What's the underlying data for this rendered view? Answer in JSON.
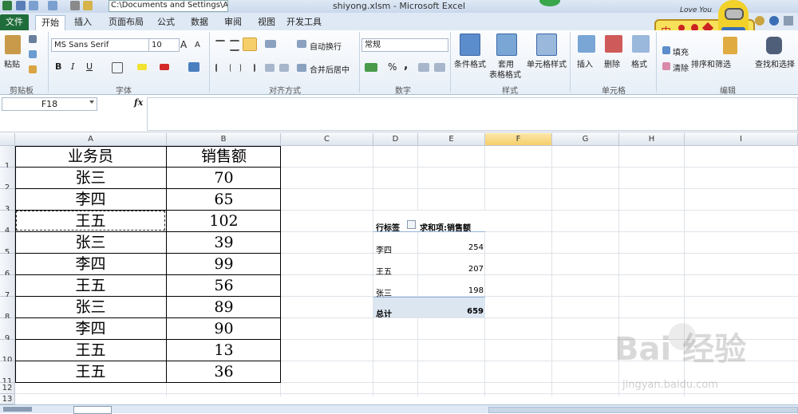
{
  "window": {
    "title": "shiyong.xlsm - Microsoft Excel",
    "path_field": "C:\\Documents and Settings\\Adr"
  },
  "tabs": [
    {
      "label": "文件"
    },
    {
      "label": "开始"
    },
    {
      "label": "插入"
    },
    {
      "label": "页面布局"
    },
    {
      "label": "公式"
    },
    {
      "label": "数据"
    },
    {
      "label": "审阅"
    },
    {
      "label": "视图"
    },
    {
      "label": "开发工具"
    }
  ],
  "ribbon": {
    "paste": "粘贴",
    "font_name": "MS Sans Serif",
    "font_size": "10",
    "wrap_text": "自动换行",
    "merge_center": "合并后居中",
    "number_format": "常规",
    "conditional_format": "条件格式",
    "table_format": "套用",
    "table_format2": "表格格式",
    "cell_style": "单元格样式",
    "insert": "插入",
    "delete": "删除",
    "format": "格式",
    "fill": "填充",
    "clear": "清除",
    "sort_filter": "排序和筛选",
    "find_select": "查找和选择",
    "groups": {
      "clipboard": "剪贴板",
      "font": "字体",
      "alignment": "对齐方式",
      "number": "数字",
      "styles": "样式",
      "cells": "单元格",
      "editing": "编辑"
    },
    "bold": "B",
    "italic": "I",
    "underline": "U",
    "percent": "%",
    "comma": ","
  },
  "ime": {
    "label": "中"
  },
  "mascot": {
    "text": "Love You"
  },
  "formula_bar": {
    "name_box": "F18",
    "fx": "fx"
  },
  "columns": [
    "A",
    "B",
    "C",
    "D",
    "E",
    "F",
    "G",
    "H",
    "I"
  ],
  "rows": [
    "1",
    "2",
    "3",
    "4",
    "5",
    "6",
    "7",
    "8",
    "9",
    "10",
    "11",
    "12",
    "13"
  ],
  "table": {
    "header": [
      "业务员",
      "销售额"
    ],
    "rows": [
      [
        "张三",
        "70"
      ],
      [
        "李四",
        "65"
      ],
      [
        "王五",
        "102"
      ],
      [
        "张三",
        "39"
      ],
      [
        "李四",
        "99"
      ],
      [
        "王五",
        "56"
      ],
      [
        "张三",
        "89"
      ],
      [
        "李四",
        "90"
      ],
      [
        "王五",
        "13"
      ],
      [
        "王五",
        "36"
      ]
    ]
  },
  "pivot": {
    "row_label": "行标签",
    "value_label": "求和项:销售额",
    "rows": [
      {
        "name": "李四",
        "value": "254"
      },
      {
        "name": "王五",
        "value": "207"
      },
      {
        "name": "张三",
        "value": "198"
      }
    ],
    "total_label": "总计",
    "total_value": "659"
  },
  "watermark": {
    "main": "Bai 经验",
    "sub": "jingyan.baidu.com"
  },
  "colors": {
    "file_tab": "#1f6d3a",
    "selected_header": "#f6cf6b",
    "pivot_total_bg": "#dce6f1"
  }
}
